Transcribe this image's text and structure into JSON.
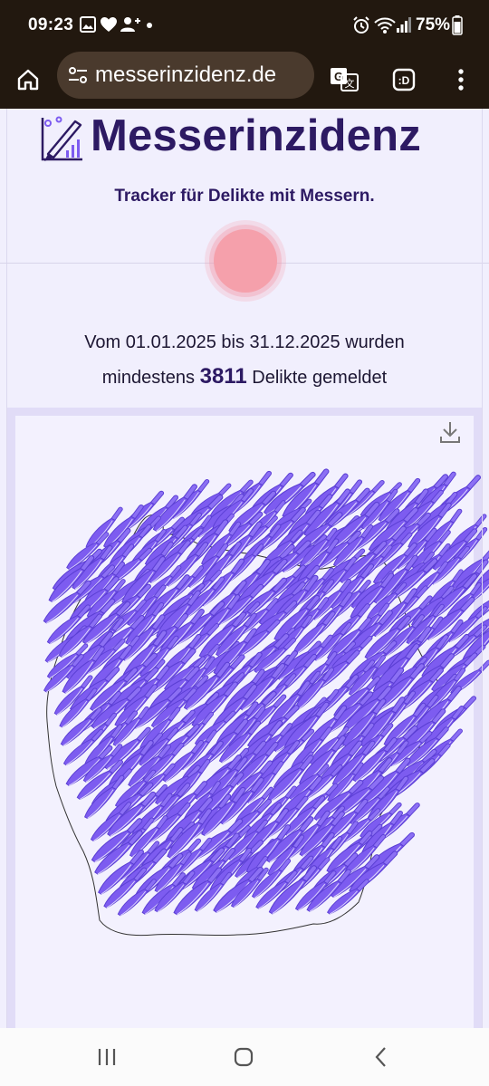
{
  "status_bar": {
    "time": "09:23",
    "battery": "75%",
    "icons": [
      "gallery-icon",
      "heart-icon",
      "add-person-icon",
      "dot-icon",
      "alarm-icon",
      "wifi-icon",
      "signal-icon",
      "battery-icon"
    ]
  },
  "browser": {
    "url": "messerinzidenz.de",
    "buttons": [
      "home-icon",
      "site-settings-icon",
      "translate-icon",
      "tab-switcher-icon",
      "more-vert-icon"
    ]
  },
  "page": {
    "title": "Messerinzidenz",
    "tagline": "Tracker für Delikte mit Messern.",
    "summary_line1": "Vom 01.01.2025 bis 31.12.2025 wurden",
    "summary_prefix": "mindestens",
    "incident_count": "3811",
    "summary_suffix": "Delikte gemeldet"
  },
  "colors": {
    "title": "#2d1a63",
    "knife_fill": "#7d5cf0",
    "knife_stroke": "#5b3fd4",
    "pulse": "#f5a0ab",
    "chrome": "#22180f"
  },
  "navigation": {
    "buttons": [
      "recent-apps-icon",
      "home-nav-icon",
      "back-icon"
    ]
  }
}
